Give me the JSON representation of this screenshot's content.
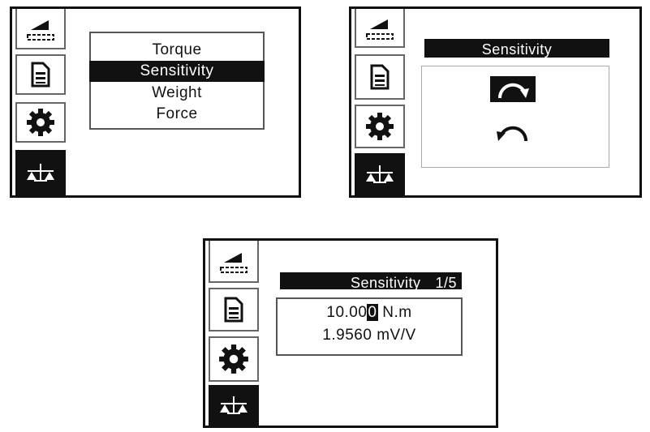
{
  "screen1": {
    "sidebar": [
      {
        "icon": "ramp-icon"
      },
      {
        "icon": "document-icon"
      },
      {
        "icon": "gear-icon"
      },
      {
        "icon": "scale-icon",
        "active": true
      }
    ],
    "menu": {
      "items": [
        "Torque",
        "Sensitivity",
        "Weight",
        "Force"
      ],
      "selected": "Sensitivity"
    }
  },
  "screen2": {
    "sidebar": [
      {
        "icon": "ramp-icon"
      },
      {
        "icon": "document-icon"
      },
      {
        "icon": "gear-icon"
      },
      {
        "icon": "scale-icon",
        "active": true
      }
    ],
    "title": "Sensitivity",
    "options": [
      {
        "icon": "clockwise-arrow-icon",
        "selected": true
      },
      {
        "icon": "counterclockwise-arrow-icon",
        "selected": false
      }
    ]
  },
  "screen3": {
    "sidebar": [
      {
        "icon": "ramp-icon"
      },
      {
        "icon": "document-icon"
      },
      {
        "icon": "gear-icon"
      },
      {
        "icon": "scale-icon",
        "active": true
      }
    ],
    "title": "Sensitivity",
    "page": "1/5",
    "value_prefix": "10.00",
    "value_cursor_digit": "0",
    "value_unit": " N.m",
    "sensitivity_value": "1.9560",
    "sensitivity_unit": "mV/V"
  },
  "colors": {
    "foreground": "#111111",
    "background": "#ffffff",
    "border": "#555555"
  }
}
